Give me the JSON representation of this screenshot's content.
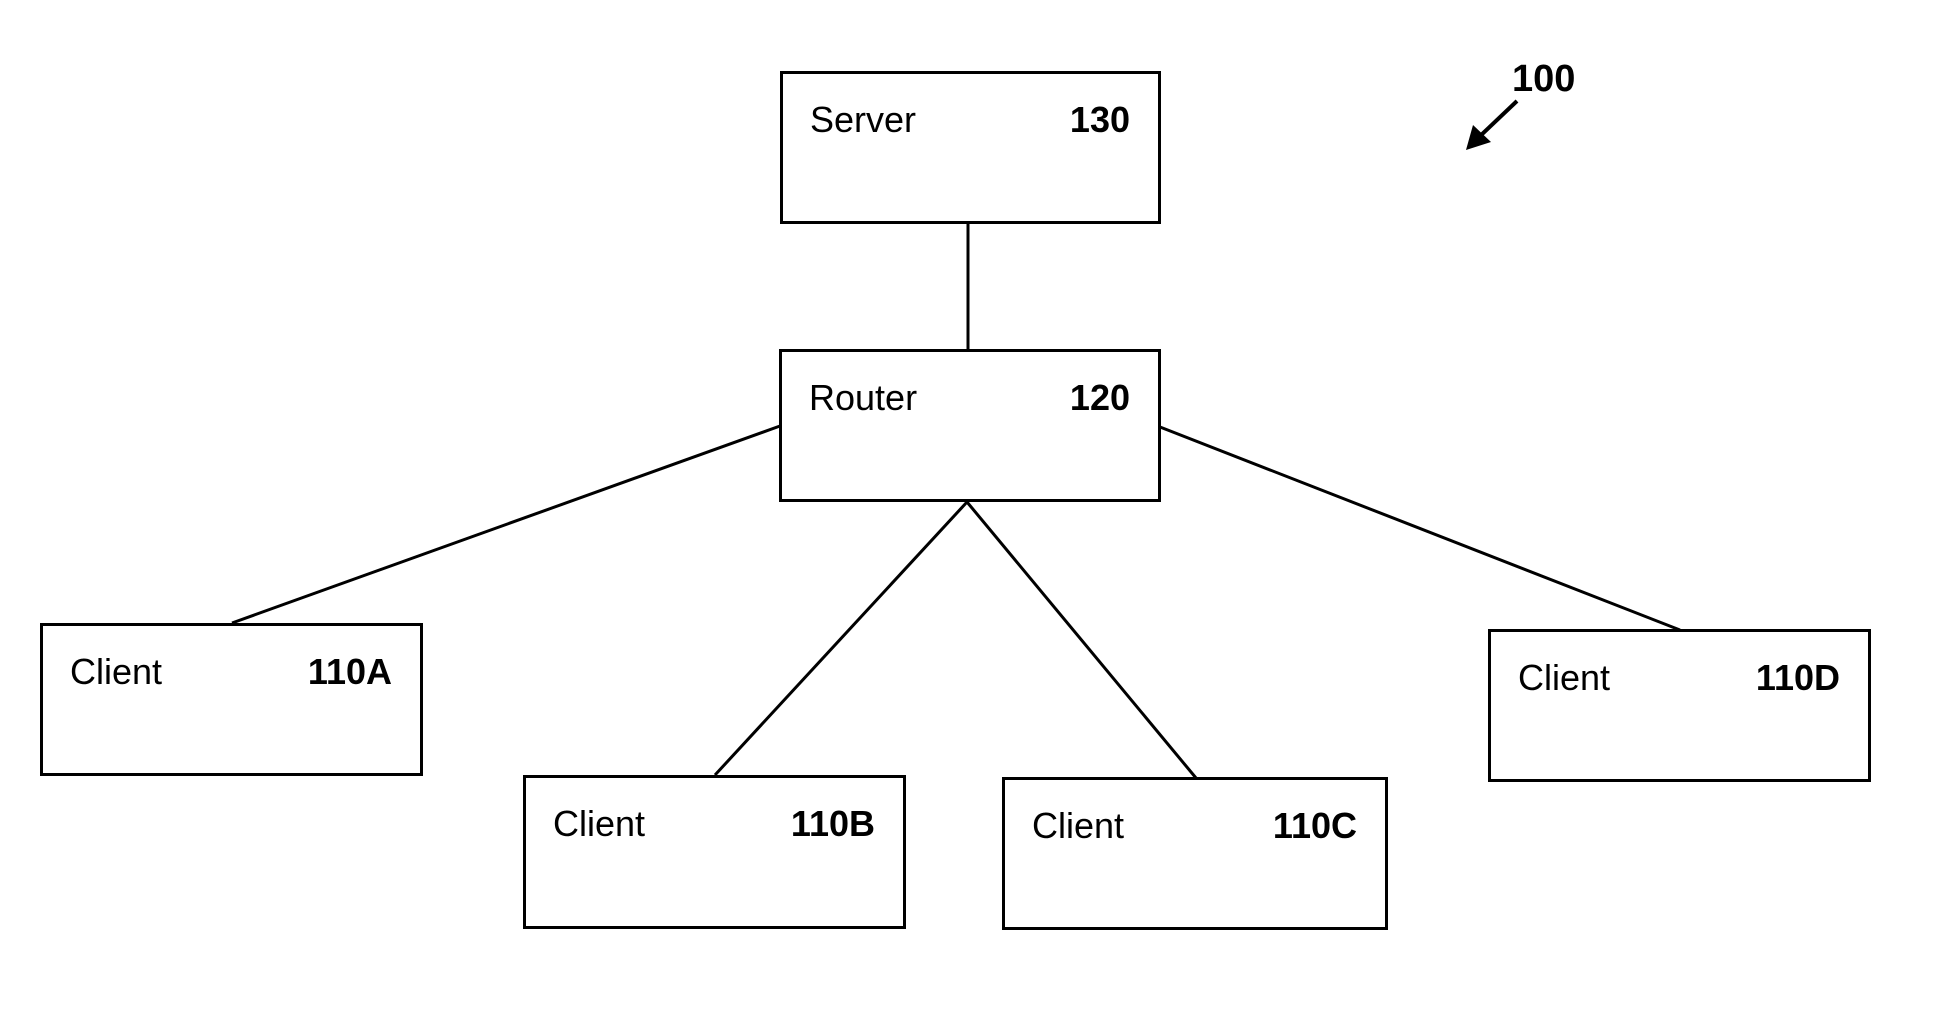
{
  "figure": {
    "reference_label": "100"
  },
  "nodes": [
    {
      "id": "server",
      "name": "Server",
      "ref": "130"
    },
    {
      "id": "router",
      "name": "Router",
      "ref": "120"
    },
    {
      "id": "client-a",
      "name": "Client",
      "ref": "110A"
    },
    {
      "id": "client-b",
      "name": "Client",
      "ref": "110B"
    },
    {
      "id": "client-c",
      "name": "Client",
      "ref": "110C"
    },
    {
      "id": "client-d",
      "name": "Client",
      "ref": "110D"
    }
  ],
  "edges": [
    {
      "from": "server",
      "to": "router"
    },
    {
      "from": "router",
      "to": "client-a"
    },
    {
      "from": "router",
      "to": "client-b"
    },
    {
      "from": "router",
      "to": "client-c"
    },
    {
      "from": "router",
      "to": "client-d"
    }
  ]
}
